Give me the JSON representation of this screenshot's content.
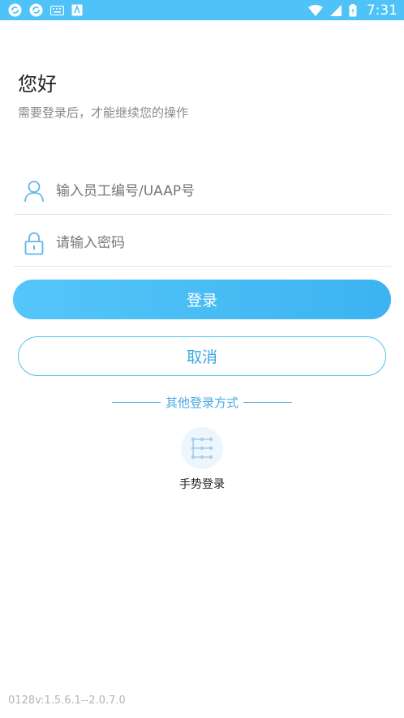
{
  "status_bar": {
    "time": "7:31",
    "left_icons": [
      "sync-icon",
      "sync-icon",
      "keyboard-icon",
      "app-notification-icon"
    ],
    "right_icons": [
      "wifi-icon",
      "signal-icon",
      "battery-icon"
    ],
    "color": "#4fc3f7"
  },
  "greeting": {
    "title": "您好",
    "subtitle": "需要登录后，才能继续您的操作"
  },
  "form": {
    "username_placeholder": "输入员工编号/UAAP号",
    "password_placeholder": "请输入密码",
    "login_label": "登录",
    "cancel_label": "取消"
  },
  "other_login": {
    "title": "其他登录方式",
    "gesture_label": "手势登录"
  },
  "version": "0128v:1.5.6.1--2.0.7.0",
  "colors": {
    "accent": "#4fc3f7",
    "accent_dark": "#3aa7e3"
  }
}
